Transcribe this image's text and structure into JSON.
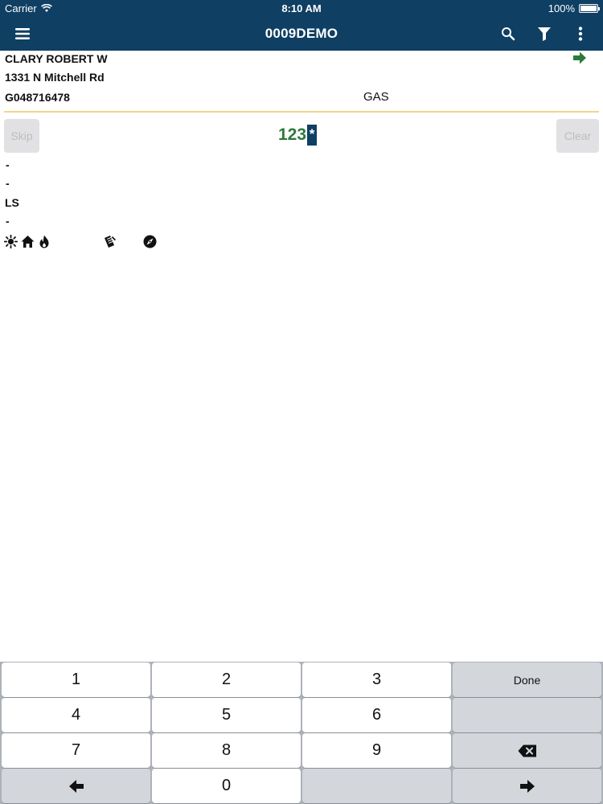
{
  "status_bar": {
    "carrier": "Carrier",
    "time": "8:10 AM",
    "battery": "100%"
  },
  "nav": {
    "title": "0009DEMO",
    "icons": [
      "menu-icon",
      "search-icon",
      "filter-icon",
      "more-vertical-icon"
    ]
  },
  "customer": {
    "name": "CLARY ROBERT W",
    "address": "1331 N Mitchell Rd",
    "account": "G048716478",
    "service": "GAS"
  },
  "reading": {
    "skip_label": "Skip",
    "value": "123",
    "cursor": "*",
    "clear_label": "Clear"
  },
  "details": {
    "lines": [
      "-",
      "-",
      "LS",
      "-"
    ]
  },
  "info_icons": [
    "sun-icon",
    "home-icon",
    "flame-icon",
    "note-icon",
    "compass-icon"
  ],
  "keyboard": {
    "row1": [
      "1",
      "2",
      "3"
    ],
    "row2": [
      "4",
      "5",
      "6"
    ],
    "row3": [
      "7",
      "8",
      "9"
    ],
    "zero": "0",
    "done": "Done"
  },
  "colors": {
    "nav": "#0f3f63",
    "reading": "#2e7a3c",
    "divider": "#f2d58a",
    "arrow": "#2e7a3c"
  }
}
